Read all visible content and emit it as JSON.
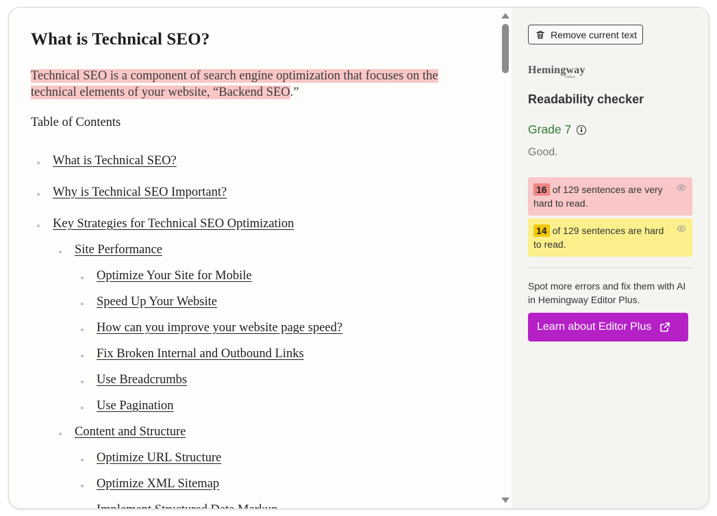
{
  "editor": {
    "title": "What is Technical SEO?",
    "intro_highlighted": "Technical SEO is a component of search engine optimization that focuses on the technical elements of your website, “Backend SEO",
    "intro_rest": ".”",
    "toc_heading": "Table of Contents",
    "toc": [
      {
        "label": "What is Technical SEO?",
        "level": 1
      },
      {
        "label": "Why is Technical SEO Important?",
        "level": 1
      },
      {
        "label": "Key Strategies for Technical SEO Optimization",
        "level": 1
      },
      {
        "label": "Site Performance",
        "level": 2
      },
      {
        "label": "Optimize Your Site for Mobile",
        "level": 3
      },
      {
        "label": "Speed Up Your Website",
        "level": 3
      },
      {
        "label": "How can you improve your website page speed?",
        "level": 3
      },
      {
        "label": "Fix Broken Internal and Outbound Links",
        "level": 3
      },
      {
        "label": "Use Breadcrumbs",
        "level": 3
      },
      {
        "label": "Use Pagination",
        "level": 3
      },
      {
        "label": "Content and Structure",
        "level": 2
      },
      {
        "label": "Optimize URL Structure",
        "level": 3
      },
      {
        "label": "Optimize XML Sitemap",
        "level": 3
      },
      {
        "label": "Implement Structured Data Markup",
        "level": 3
      }
    ]
  },
  "sidebar": {
    "remove_button": "Remove current text",
    "logo": "Hemingway",
    "logo_sub": "Editor",
    "section_title": "Readability checker",
    "grade": "Grade 7",
    "grade_desc": "Good.",
    "very_hard": {
      "count": "16",
      "text": "of 129 sentences are very hard to read."
    },
    "hard": {
      "count": "14",
      "text": "of 129 sentences are hard to read."
    },
    "promo": "Spot more errors and fix them with AI in Hemingway Editor Plus.",
    "plus_button": "Learn about Editor Plus"
  },
  "colors": {
    "very_hard_bg": "#f9c7c7",
    "hard_bg": "#fbf08c",
    "grade_green": "#2e7d32",
    "plus_purple": "#b521c7"
  },
  "icons": [
    "trash-icon",
    "info-icon",
    "eye-icon",
    "external-link-icon",
    "scroll-up-icon",
    "scroll-down-icon"
  ]
}
